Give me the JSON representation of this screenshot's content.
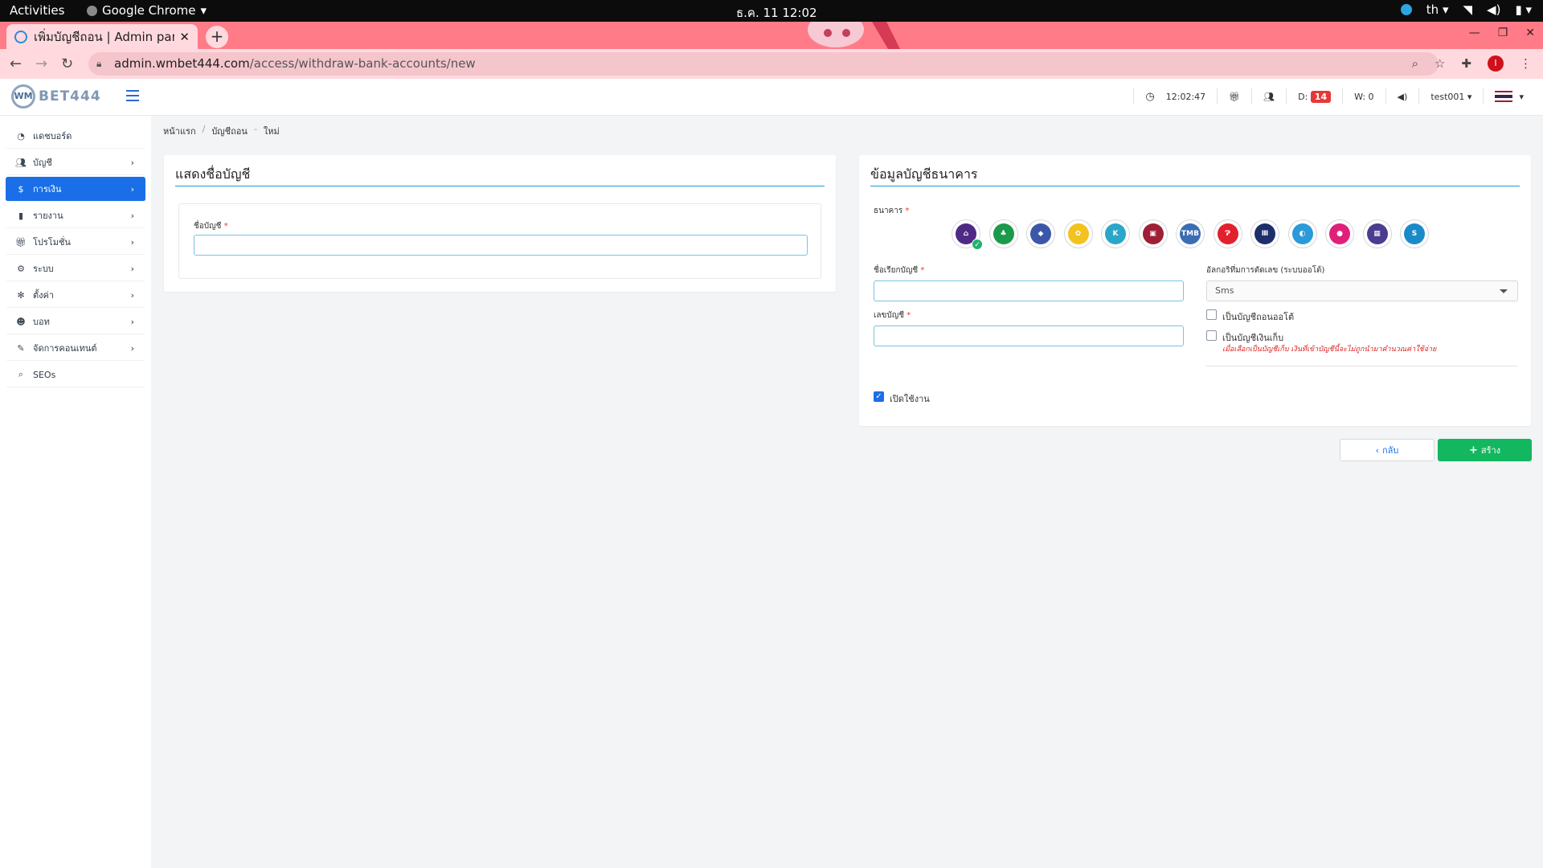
{
  "os_bar": {
    "activities": "Activities",
    "app_name": "Google Chrome",
    "clock": "ธ.ค. 11  12:02",
    "input_lang": "th"
  },
  "browser": {
    "tab_title": "เพิ่มบัญชีถอน | Admin panel",
    "url_host": "admin.wmbet444.com",
    "url_path": "/access/withdraw-bank-accounts/new",
    "profile_initial": "I"
  },
  "header": {
    "logo_text": "BET444",
    "logo_mark": "WM",
    "time": "12:02:47",
    "d_label": "D:",
    "d_count": "14",
    "w_label": "W: 0",
    "username": "test001"
  },
  "sidebar": {
    "items": [
      {
        "label": "แดชบอร์ด",
        "icon": "dashboard-icon",
        "has_children": false,
        "active": false
      },
      {
        "label": "บัญชี",
        "icon": "users-icon",
        "has_children": true,
        "active": false
      },
      {
        "label": "การเงิน",
        "icon": "dollar-icon",
        "has_children": true,
        "active": true
      },
      {
        "label": "รายงาน",
        "icon": "file-icon",
        "has_children": true,
        "active": false
      },
      {
        "label": "โปรโมชั่น",
        "icon": "gift-icon",
        "has_children": true,
        "active": false
      },
      {
        "label": "ระบบ",
        "icon": "cogs-icon",
        "has_children": true,
        "active": false
      },
      {
        "label": "ตั้งค่า",
        "icon": "gear-icon",
        "has_children": true,
        "active": false
      },
      {
        "label": "บอท",
        "icon": "robot-icon",
        "has_children": true,
        "active": false
      },
      {
        "label": "จัดการคอนเทนต์",
        "icon": "edit-icon",
        "has_children": true,
        "active": false
      },
      {
        "label": "SEOs",
        "icon": "search-icon",
        "has_children": false,
        "active": false
      }
    ]
  },
  "breadcrumb": {
    "home": "หน้าแรก",
    "section": "บัญชีถอน",
    "current": "ใหม่"
  },
  "left_card": {
    "title": "แสดงชื่อบัญชี",
    "account_name_label": "ชื่อบัญชี",
    "account_name_value": ""
  },
  "right_card": {
    "title": "ข้อมูลบัญชีธนาคาร",
    "bank_label": "ธนาคาร",
    "banks": [
      {
        "name": "scb-bank-icon",
        "color": "#4e2a84",
        "glyph": "⌂",
        "selected": true
      },
      {
        "name": "kbank-bank-icon",
        "color": "#1b9a4b",
        "glyph": "♣",
        "selected": false
      },
      {
        "name": "ktb-bank-icon",
        "color": "#3b57a8",
        "glyph": "◆",
        "selected": false
      },
      {
        "name": "bay-bank-icon",
        "color": "#f4c21f",
        "glyph": "✿",
        "selected": false
      },
      {
        "name": "kkp-bank-icon",
        "color": "#2aa6c9",
        "glyph": "K",
        "selected": false
      },
      {
        "name": "tisco-bank-icon",
        "color": "#9e1f36",
        "glyph": "▣",
        "selected": false
      },
      {
        "name": "tmb-bank-icon",
        "color": "#3b6db3",
        "glyph": "TMB",
        "selected": false
      },
      {
        "name": "cimb-bank-icon",
        "color": "#e3202d",
        "glyph": "Ɂ",
        "selected": false
      },
      {
        "name": "uob-bank-icon",
        "color": "#1d2f6b",
        "glyph": "Ⅲ",
        "selected": false
      },
      {
        "name": "bbl-bank-icon",
        "color": "#2a9ad8",
        "glyph": "◐",
        "selected": false
      },
      {
        "name": "gsb-bank-icon",
        "color": "#e01f7a",
        "glyph": "●",
        "selected": false
      },
      {
        "name": "baac-bank-icon",
        "color": "#4b3c8f",
        "glyph": "▦",
        "selected": false
      },
      {
        "name": "scbt-bank-icon",
        "color": "#1a8bc9",
        "glyph": "S",
        "selected": false
      }
    ],
    "account_alias_label": "ชื่อเรียกบัญชี",
    "account_alias_value": "",
    "account_number_label": "เลขบัญชี",
    "account_number_value": "",
    "algorithm_label": "อัลกอริทึ่มการตัดเลข (ระบบออโต้)",
    "algorithm_value": "Sms",
    "auto_withdraw_label": "เป็นบัญชีถอนออโต้",
    "auto_withdraw_checked": false,
    "savings_label": "เป็นบัญชีเงินเก็บ",
    "savings_checked": false,
    "savings_hint": "เมื่อเลือกเป็นบัญชีเก็บ เงินที่เข้าบัญชีนี้จะไม่ถูกนำมาคำนวณค่าใช้จ่าย",
    "enabled_label": "เปิดใช้งาน",
    "enabled_checked": true
  },
  "actions": {
    "back_label": "กลับ",
    "create_label": "สร้าง"
  },
  "colors": {
    "primary": "#1a6fe8",
    "success": "#13b75f",
    "danger": "#e53935",
    "accent_line": "#1f9bd6",
    "tab_strip": "#ff7b88"
  }
}
